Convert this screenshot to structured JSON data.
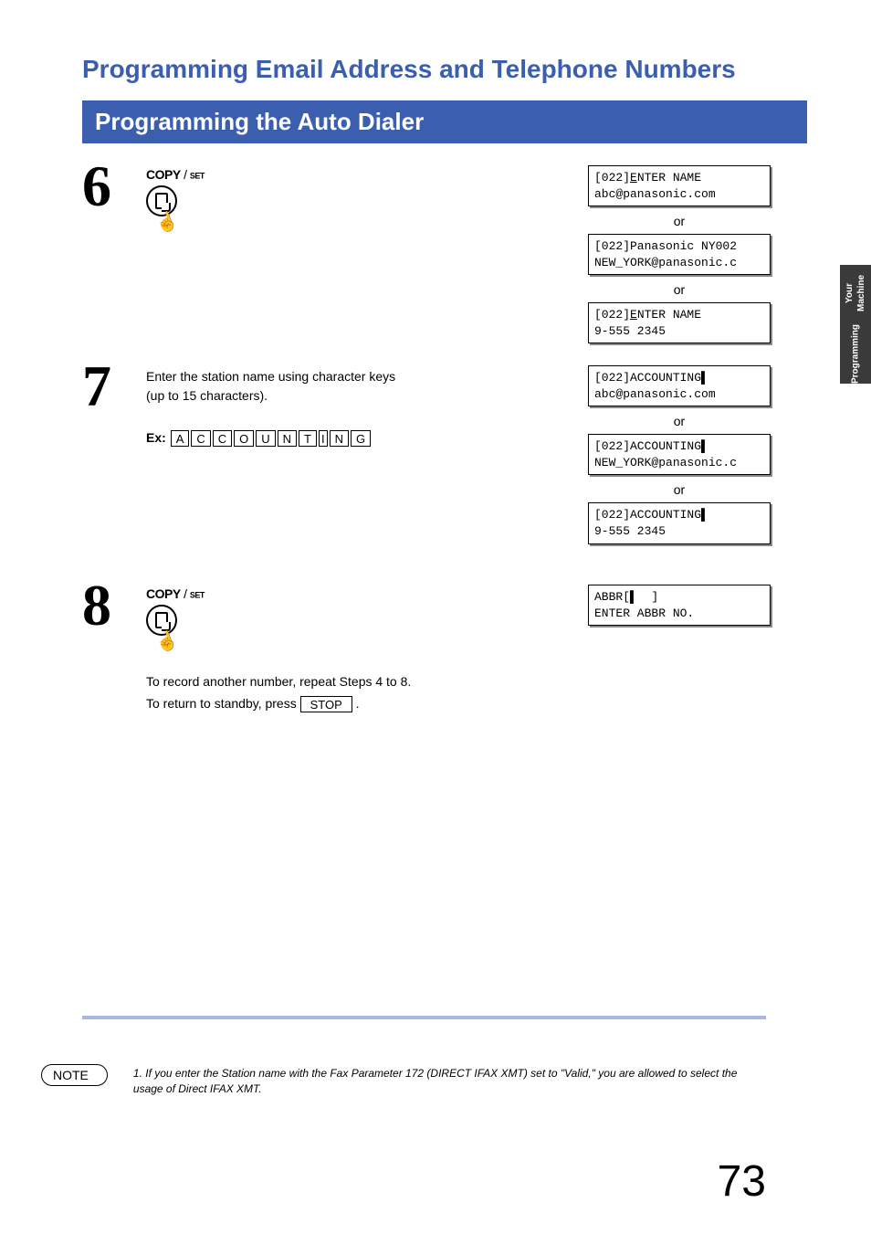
{
  "page_title": "Programming Email Address and Telephone Numbers",
  "section_bar": "Programming the Auto Dialer",
  "side_tab_line1": "Programming",
  "side_tab_line2": "Your Machine",
  "or": "or",
  "copy_set_copy": "COPY",
  "copy_set_slash": " / ",
  "copy_set_set": "SET",
  "step6_num": "6",
  "lcd6a_l1": "[022]",
  "lcd6a_l1b": "E",
  "lcd6a_l1c": "NTER NAME",
  "lcd6a_l2": "abc@panasonic.com",
  "lcd6b_l1": "[022]Panasonic NY002",
  "lcd6b_l2": "NEW_YORK@panasonic.c",
  "lcd6c_l1a": "[022]",
  "lcd6c_l1b": "E",
  "lcd6c_l1c": "NTER NAME",
  "lcd6c_l2": "9-555 2345",
  "step7_num": "7",
  "step7_instr1": "Enter the station name using character keys",
  "step7_instr2": "(up to 15 characters).",
  "ex_label": "Ex:",
  "keys": [
    "A",
    "C",
    "C",
    "O",
    "U",
    "N",
    "T",
    "I",
    "N",
    "G"
  ],
  "lcd7a_l1": "[022]ACCOUNTING▌",
  "lcd7a_l2": "abc@panasonic.com",
  "lcd7b_l1": "[022]ACCOUNTING▌",
  "lcd7b_l2": "NEW_YORK@panasonic.c",
  "lcd7c_l1": "[022]ACCOUNTING▌",
  "lcd7c_l2": "9-555 2345",
  "step8_num": "8",
  "lcd8_l1": "ABBR[▌  ]",
  "lcd8_l2": "ENTER ABBR NO.",
  "step8_n1": "To record another number, repeat Steps 4 to 8.",
  "step8_n2a": "To return to standby, press ",
  "stop_label": "STOP",
  "step8_n2b": " .",
  "note_label": "NOTE",
  "note_text": "1. If you enter the Station name with the Fax Parameter 172 (DIRECT IFAX XMT) set to \"Valid,\" you are allowed to select the usage of Direct IFAX XMT.",
  "page_number": "73"
}
